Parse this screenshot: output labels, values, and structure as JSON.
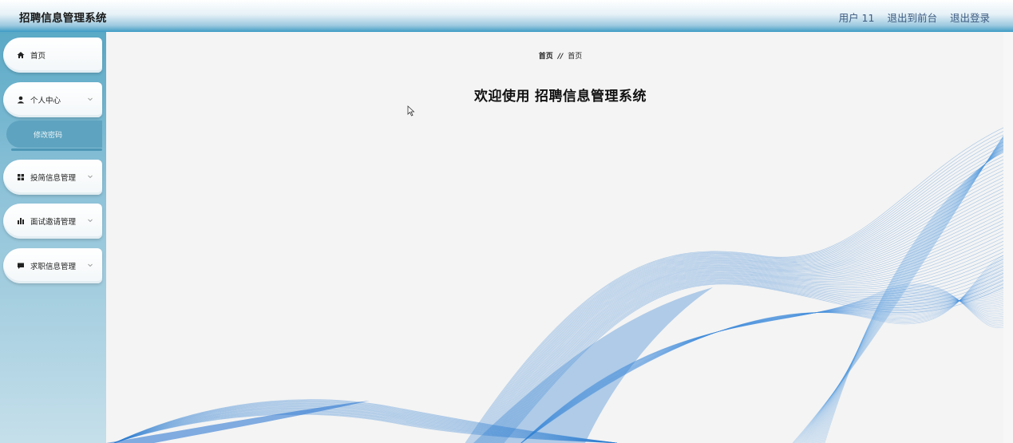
{
  "header": {
    "title": "招聘信息管理系统",
    "user": "用户 11",
    "to_front": "退出到前台",
    "logout": "退出登录"
  },
  "sidebar": {
    "items": [
      {
        "label": "首页",
        "icon": "home-icon"
      },
      {
        "label": "个人中心",
        "icon": "user-icon",
        "expanded": true,
        "children": [
          {
            "label": "修改密码",
            "active": true
          }
        ]
      },
      {
        "label": "投简信息管理",
        "icon": "grid-icon"
      },
      {
        "label": "面试邀请管理",
        "icon": "bar-chart-icon"
      },
      {
        "label": "求职信息管理",
        "icon": "message-icon"
      }
    ]
  },
  "main": {
    "breadcrumb": {
      "first": "首页",
      "separator": "//",
      "current": "首页"
    },
    "welcome_prefix": "欢迎使用",
    "welcome_system": "招聘信息管理系统"
  },
  "colors": {
    "header_accent": "#3d9bc4",
    "sidebar_accent": "#5ea3bf",
    "wave_blue": "#2f7fd0",
    "header_link": "#3d5a80"
  }
}
